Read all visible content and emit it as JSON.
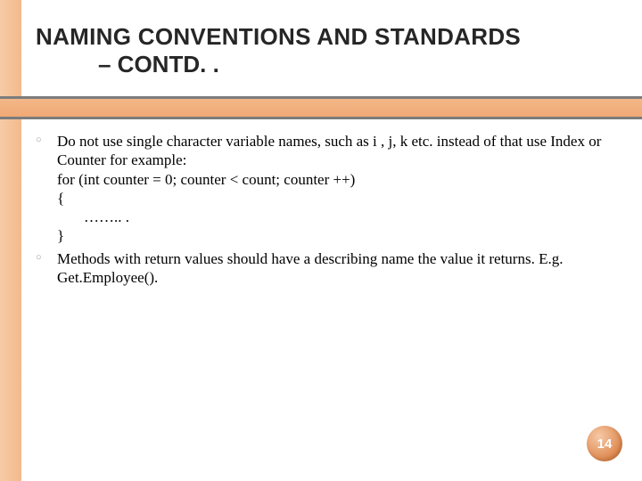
{
  "title": {
    "line1": "NAMING CONVENTIONS AND STANDARDS",
    "line2": "– CONTD. ."
  },
  "bullets": [
    {
      "text": "Do not use single character variable names, such as i , j, k etc. instead of that use Index or Counter for example:",
      "code": [
        "for (int counter = 0;  counter < count;  counter ++)",
        "{",
        "    …….. .",
        "}"
      ]
    },
    {
      "text": "Methods with return values should have a describing name the value it returns. E.g. Get.Employee().",
      "code": []
    }
  ],
  "page_number": "14"
}
